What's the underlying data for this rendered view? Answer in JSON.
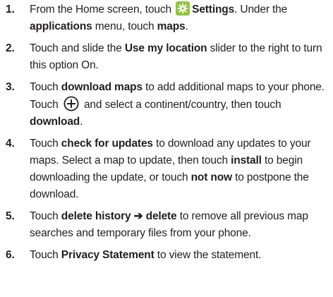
{
  "steps": [
    {
      "number": "1.",
      "parts": {
        "a": "From the Home screen, touch ",
        "b": "Settings",
        "c": ". Under the ",
        "d": "applications",
        "e": " menu, touch ",
        "f": "maps",
        "g": "."
      }
    },
    {
      "number": "2.",
      "parts": {
        "a": "Touch and slide the ",
        "b": "Use my location",
        "c": " slider to the right to turn this option On."
      }
    },
    {
      "number": "3.",
      "parts": {
        "a": "Touch ",
        "b": "download maps",
        "c": " to add additional maps to your phone. Touch ",
        "d": " and select a continent/country, then touch ",
        "e": "download",
        "f": "."
      }
    },
    {
      "number": "4.",
      "parts": {
        "a": "Touch ",
        "b": "check for updates",
        "c": " to download any updates to your maps. Select a map to update, then touch ",
        "d": "install",
        "e": " to begin downloading the update, or touch ",
        "f": "not now",
        "g": " to postpone the download."
      }
    },
    {
      "number": "5.",
      "parts": {
        "a": "Touch ",
        "b": "delete history",
        "arrow": " ➔ ",
        "c": "delete",
        "d": " to remove all previous map searches and temporary files from your phone."
      }
    },
    {
      "number": "6.",
      "parts": {
        "a": "Touch ",
        "b": "Privacy Statement",
        "c": " to view the statement."
      }
    }
  ],
  "icons": {
    "settings": "gear-icon",
    "add": "plus-circle-icon",
    "settings_badge_color": "#8dc63f"
  }
}
